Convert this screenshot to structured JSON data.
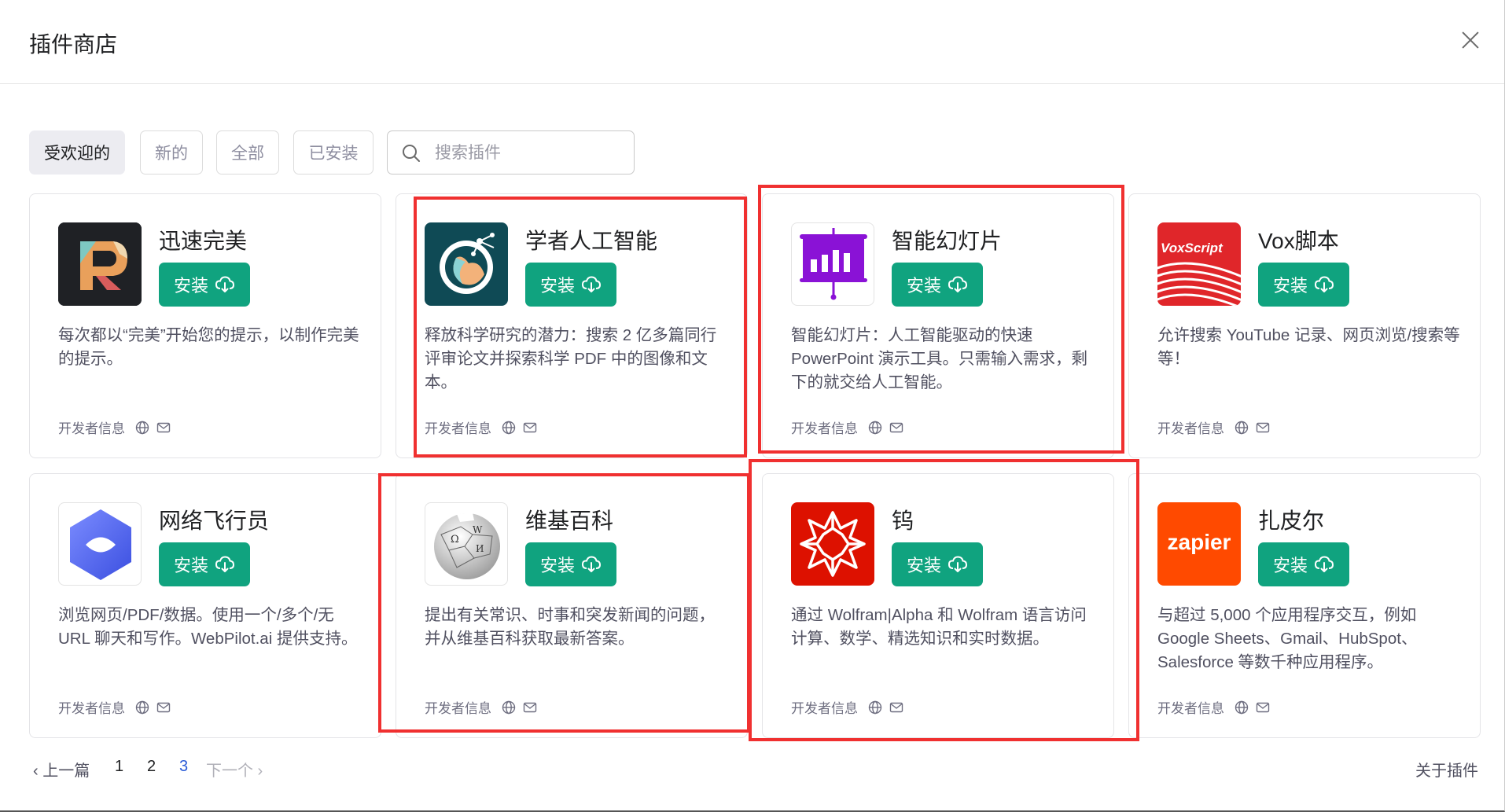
{
  "modal": {
    "title": "插件商店"
  },
  "filters": [
    {
      "label": "受欢迎的",
      "active": true
    },
    {
      "label": "新的",
      "active": false
    },
    {
      "label": "全部",
      "active": false
    },
    {
      "label": "已安装",
      "active": false
    }
  ],
  "search": {
    "placeholder": "搜索插件",
    "value": ""
  },
  "install_label": "安装",
  "dev_info_label": "开发者信息",
  "plugins": [
    {
      "name": "迅速完美",
      "desc": "每次都以“完美”开始您的提示，以制作完美的提示。",
      "icon": "prompt-perfect-logo"
    },
    {
      "name": "学者人工智能",
      "desc": "释放科学研究的潜力：搜索 2 亿多篇同行评审论文并探索科学 PDF 中的图像和文本。",
      "icon": "scholarai-logo"
    },
    {
      "name": "智能幻灯片",
      "desc": "智能幻灯片：人工智能驱动的快速 PowerPoint 演示工具。只需输入需求，剩下的就交给人工智能。",
      "icon": "presentation-chart-logo"
    },
    {
      "name": "Vox脚本",
      "desc": "允许搜索 YouTube 记录、网页浏览/搜索等等！",
      "icon": "voxscript-logo",
      "logo_text": "VoxScript"
    },
    {
      "name": "网络飞行员",
      "desc": "浏览网页/PDF/数据。使用一个/多个/无 URL 聊天和写作。WebPilot.ai 提供支持。",
      "icon": "webpilot-logo"
    },
    {
      "name": "维基百科",
      "desc": "提出有关常识、时事和突发新闻的问题，并从维基百科获取最新答案。",
      "icon": "wikipedia-globe-logo"
    },
    {
      "name": "钨",
      "desc": "通过 Wolfram|Alpha 和 Wolfram 语言访问计算、数学、精选知识和实时数据。",
      "icon": "wolfram-logo"
    },
    {
      "name": "扎皮尔",
      "desc": "与超过 5,000 个应用程序交互，例如 Google Sheets、Gmail、HubSpot、Salesforce 等数千种应用程序。",
      "icon": "zapier-logo",
      "logo_text": "zapier"
    }
  ],
  "pagination": {
    "prev": "上一篇",
    "pages": [
      "1",
      "2",
      "3"
    ],
    "current": "3",
    "next": "下一个"
  },
  "footer": {
    "about": "关于插件"
  },
  "colors": {
    "accent": "#10a37f",
    "highlight": "#f03030"
  }
}
